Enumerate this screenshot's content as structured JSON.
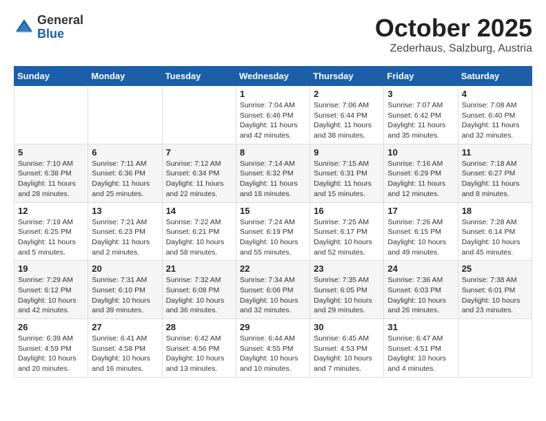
{
  "header": {
    "logo_general": "General",
    "logo_blue": "Blue",
    "month": "October 2025",
    "location": "Zederhaus, Salzburg, Austria"
  },
  "weekdays": [
    "Sunday",
    "Monday",
    "Tuesday",
    "Wednesday",
    "Thursday",
    "Friday",
    "Saturday"
  ],
  "weeks": [
    [
      {
        "day": "",
        "info": ""
      },
      {
        "day": "",
        "info": ""
      },
      {
        "day": "",
        "info": ""
      },
      {
        "day": "1",
        "info": "Sunrise: 7:04 AM\nSunset: 6:46 PM\nDaylight: 11 hours\nand 42 minutes."
      },
      {
        "day": "2",
        "info": "Sunrise: 7:06 AM\nSunset: 6:44 PM\nDaylight: 11 hours\nand 38 minutes."
      },
      {
        "day": "3",
        "info": "Sunrise: 7:07 AM\nSunset: 6:42 PM\nDaylight: 11 hours\nand 35 minutes."
      },
      {
        "day": "4",
        "info": "Sunrise: 7:08 AM\nSunset: 6:40 PM\nDaylight: 11 hours\nand 32 minutes."
      }
    ],
    [
      {
        "day": "5",
        "info": "Sunrise: 7:10 AM\nSunset: 6:38 PM\nDaylight: 11 hours\nand 28 minutes."
      },
      {
        "day": "6",
        "info": "Sunrise: 7:11 AM\nSunset: 6:36 PM\nDaylight: 11 hours\nand 25 minutes."
      },
      {
        "day": "7",
        "info": "Sunrise: 7:12 AM\nSunset: 6:34 PM\nDaylight: 11 hours\nand 22 minutes."
      },
      {
        "day": "8",
        "info": "Sunrise: 7:14 AM\nSunset: 6:32 PM\nDaylight: 11 hours\nand 18 minutes."
      },
      {
        "day": "9",
        "info": "Sunrise: 7:15 AM\nSunset: 6:31 PM\nDaylight: 11 hours\nand 15 minutes."
      },
      {
        "day": "10",
        "info": "Sunrise: 7:16 AM\nSunset: 6:29 PM\nDaylight: 11 hours\nand 12 minutes."
      },
      {
        "day": "11",
        "info": "Sunrise: 7:18 AM\nSunset: 6:27 PM\nDaylight: 11 hours\nand 8 minutes."
      }
    ],
    [
      {
        "day": "12",
        "info": "Sunrise: 7:19 AM\nSunset: 6:25 PM\nDaylight: 11 hours\nand 5 minutes."
      },
      {
        "day": "13",
        "info": "Sunrise: 7:21 AM\nSunset: 6:23 PM\nDaylight: 11 hours\nand 2 minutes."
      },
      {
        "day": "14",
        "info": "Sunrise: 7:22 AM\nSunset: 6:21 PM\nDaylight: 10 hours\nand 58 minutes."
      },
      {
        "day": "15",
        "info": "Sunrise: 7:24 AM\nSunset: 6:19 PM\nDaylight: 10 hours\nand 55 minutes."
      },
      {
        "day": "16",
        "info": "Sunrise: 7:25 AM\nSunset: 6:17 PM\nDaylight: 10 hours\nand 52 minutes."
      },
      {
        "day": "17",
        "info": "Sunrise: 7:26 AM\nSunset: 6:15 PM\nDaylight: 10 hours\nand 49 minutes."
      },
      {
        "day": "18",
        "info": "Sunrise: 7:28 AM\nSunset: 6:14 PM\nDaylight: 10 hours\nand 45 minutes."
      }
    ],
    [
      {
        "day": "19",
        "info": "Sunrise: 7:29 AM\nSunset: 6:12 PM\nDaylight: 10 hours\nand 42 minutes."
      },
      {
        "day": "20",
        "info": "Sunrise: 7:31 AM\nSunset: 6:10 PM\nDaylight: 10 hours\nand 39 minutes."
      },
      {
        "day": "21",
        "info": "Sunrise: 7:32 AM\nSunset: 6:08 PM\nDaylight: 10 hours\nand 36 minutes."
      },
      {
        "day": "22",
        "info": "Sunrise: 7:34 AM\nSunset: 6:06 PM\nDaylight: 10 hours\nand 32 minutes."
      },
      {
        "day": "23",
        "info": "Sunrise: 7:35 AM\nSunset: 6:05 PM\nDaylight: 10 hours\nand 29 minutes."
      },
      {
        "day": "24",
        "info": "Sunrise: 7:36 AM\nSunset: 6:03 PM\nDaylight: 10 hours\nand 26 minutes."
      },
      {
        "day": "25",
        "info": "Sunrise: 7:38 AM\nSunset: 6:01 PM\nDaylight: 10 hours\nand 23 minutes."
      }
    ],
    [
      {
        "day": "26",
        "info": "Sunrise: 6:39 AM\nSunset: 4:59 PM\nDaylight: 10 hours\nand 20 minutes."
      },
      {
        "day": "27",
        "info": "Sunrise: 6:41 AM\nSunset: 4:58 PM\nDaylight: 10 hours\nand 16 minutes."
      },
      {
        "day": "28",
        "info": "Sunrise: 6:42 AM\nSunset: 4:56 PM\nDaylight: 10 hours\nand 13 minutes."
      },
      {
        "day": "29",
        "info": "Sunrise: 6:44 AM\nSunset: 4:55 PM\nDaylight: 10 hours\nand 10 minutes."
      },
      {
        "day": "30",
        "info": "Sunrise: 6:45 AM\nSunset: 4:53 PM\nDaylight: 10 hours\nand 7 minutes."
      },
      {
        "day": "31",
        "info": "Sunrise: 6:47 AM\nSunset: 4:51 PM\nDaylight: 10 hours\nand 4 minutes."
      },
      {
        "day": "",
        "info": ""
      }
    ]
  ]
}
